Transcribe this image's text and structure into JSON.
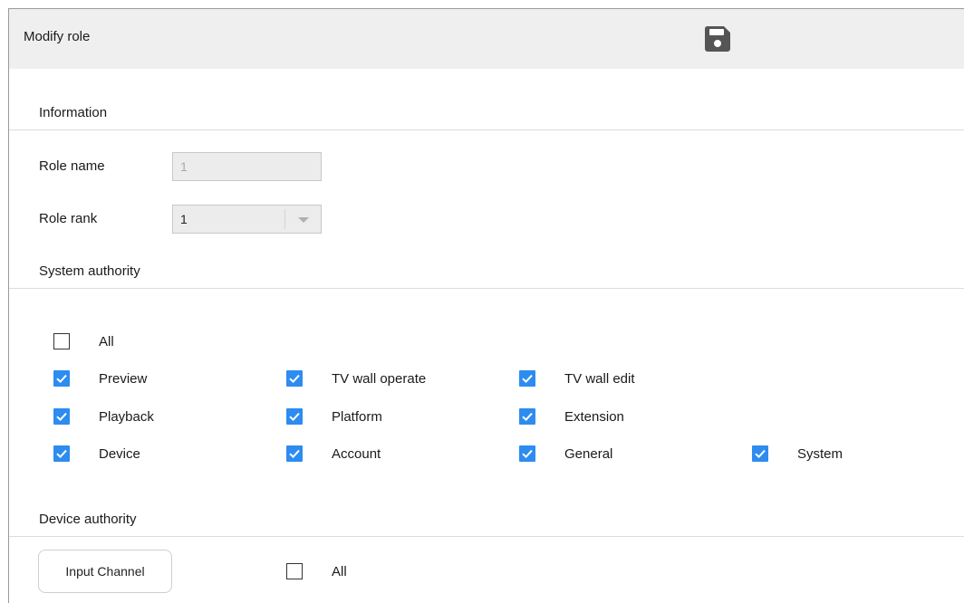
{
  "header": {
    "title": "Modify role",
    "save_icon": "save-icon"
  },
  "information": {
    "title": "Information",
    "role_name_label": "Role name",
    "role_name_value": "1",
    "role_rank_label": "Role rank",
    "role_rank_value": "1"
  },
  "system_authority": {
    "title": "System authority",
    "all_label": "All",
    "all_checked": false,
    "items": [
      {
        "label": "Preview",
        "checked": true
      },
      {
        "label": "TV wall operate",
        "checked": true
      },
      {
        "label": "TV wall edit",
        "checked": true
      },
      {
        "label": "Playback",
        "checked": true
      },
      {
        "label": "Platform",
        "checked": true
      },
      {
        "label": "Extension",
        "checked": true
      },
      {
        "label": "Device",
        "checked": true
      },
      {
        "label": "Account",
        "checked": true
      },
      {
        "label": "General",
        "checked": true
      },
      {
        "label": "System",
        "checked": true
      }
    ]
  },
  "device_authority": {
    "title": "Device authority",
    "input_channel_button": "Input Channel",
    "all_label": "All",
    "all_checked": false
  },
  "colors": {
    "accent": "#2d8cf0",
    "header_bg": "#efefef"
  }
}
